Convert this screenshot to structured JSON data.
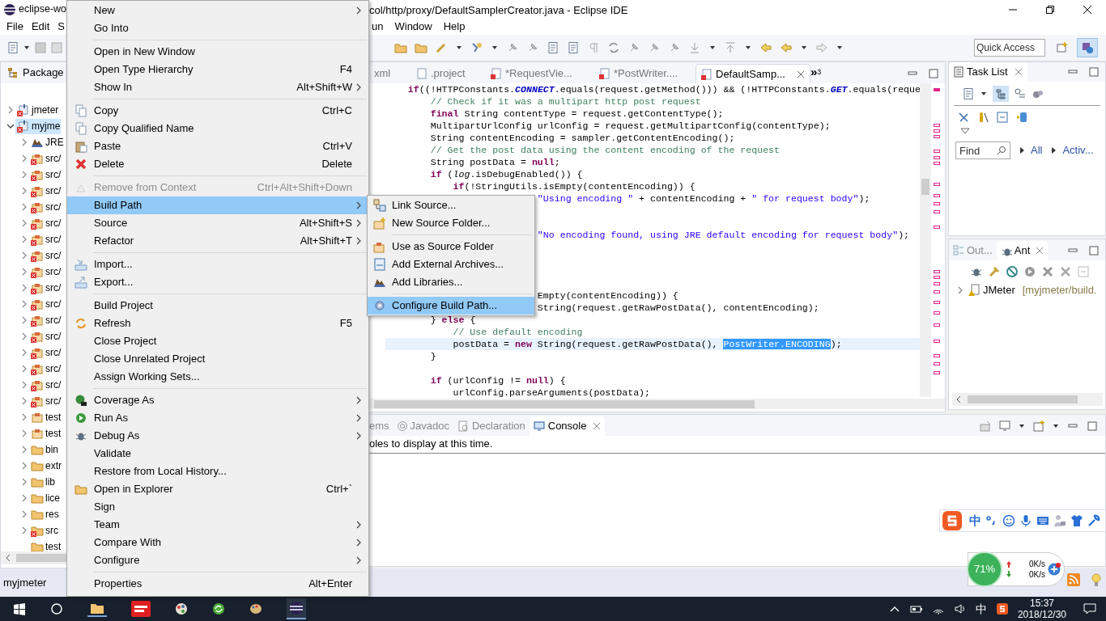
{
  "window": {
    "title_left": "eclipse-wo",
    "title_right": "col/http/proxy/DefaultSamplerCreator.java - Eclipse IDE"
  },
  "menu_bar": [
    {
      "label": "File"
    },
    {
      "label": "Edit"
    },
    {
      "label": "S"
    },
    {
      "label": "un"
    },
    {
      "label": "Window"
    },
    {
      "label": "Help"
    }
  ],
  "quick_access": {
    "placeholder": "Quick Access"
  },
  "package_explorer": {
    "title": "Package",
    "tree": [
      {
        "label": "jmeter",
        "kind": "project",
        "error": true,
        "expanded": false,
        "leaf": false,
        "selected": false
      },
      {
        "label": "myjme",
        "kind": "project",
        "error": true,
        "expanded": true,
        "leaf": false,
        "selected": true,
        "children": [
          {
            "label": "JRE",
            "kind": "library",
            "error": false,
            "leaf": false,
            "selected": false
          },
          {
            "label": "src/",
            "kind": "package",
            "error": true,
            "leaf": false,
            "selected": false
          },
          {
            "label": "src/",
            "kind": "package",
            "error": true,
            "leaf": false,
            "selected": false
          },
          {
            "label": "src/",
            "kind": "package",
            "error": true,
            "leaf": false,
            "selected": false
          },
          {
            "label": "src/",
            "kind": "package",
            "error": true,
            "leaf": false,
            "selected": false
          },
          {
            "label": "src/",
            "kind": "package",
            "error": true,
            "leaf": false,
            "selected": false
          },
          {
            "label": "src/",
            "kind": "package",
            "error": true,
            "leaf": false,
            "selected": false
          },
          {
            "label": "src/",
            "kind": "package",
            "error": true,
            "leaf": false,
            "selected": false
          },
          {
            "label": "src/",
            "kind": "package",
            "error": true,
            "leaf": false,
            "selected": false
          },
          {
            "label": "src/",
            "kind": "package",
            "error": true,
            "leaf": false,
            "selected": false
          },
          {
            "label": "src/",
            "kind": "package",
            "error": true,
            "leaf": false,
            "selected": false
          },
          {
            "label": "src/",
            "kind": "package",
            "error": true,
            "leaf": false,
            "selected": false
          },
          {
            "label": "src/",
            "kind": "package",
            "error": true,
            "leaf": false,
            "selected": false
          },
          {
            "label": "src/",
            "kind": "package",
            "error": true,
            "leaf": false,
            "selected": false
          },
          {
            "label": "src/",
            "kind": "package",
            "error": true,
            "leaf": false,
            "selected": false
          },
          {
            "label": "src/",
            "kind": "package",
            "error": true,
            "leaf": false,
            "selected": false
          },
          {
            "label": "src/",
            "kind": "package",
            "error": true,
            "leaf": false,
            "selected": false
          },
          {
            "label": "test",
            "kind": "package",
            "error": false,
            "leaf": false,
            "selected": false
          },
          {
            "label": "test",
            "kind": "package",
            "error": false,
            "leaf": false,
            "selected": false
          },
          {
            "label": "bin",
            "kind": "folder",
            "error": false,
            "leaf": false,
            "selected": false
          },
          {
            "label": "extr",
            "kind": "folder",
            "error": false,
            "leaf": false,
            "selected": false
          },
          {
            "label": "lib",
            "kind": "folder",
            "error": false,
            "leaf": false,
            "selected": false
          },
          {
            "label": "lice",
            "kind": "folder",
            "error": false,
            "leaf": false,
            "selected": false
          },
          {
            "label": "res",
            "kind": "folder",
            "error": false,
            "leaf": false,
            "selected": false
          },
          {
            "label": "src",
            "kind": "folder",
            "error": true,
            "leaf": false,
            "selected": false
          },
          {
            "label": "test",
            "kind": "folder",
            "error": false,
            "leaf": true,
            "selected": false
          }
        ]
      }
    ]
  },
  "editor": {
    "tabs": [
      {
        "label": "xml",
        "selected": false
      },
      {
        "label": ".project",
        "selected": false,
        "dirty": false
      },
      {
        "label": "*RequestVie...",
        "selected": false,
        "dirty": true
      },
      {
        "label": "*PostWriter....",
        "selected": false,
        "dirty": true
      },
      {
        "label": "DefaultSamp...",
        "selected": true,
        "dirty": false
      }
    ],
    "more_tabs": "»",
    "more_count": "3",
    "lines": [
      {
        "current": false,
        "segments": [
          {
            "text": "    if",
            "kind": "kw"
          },
          {
            "text": "((!HTTPConstants.",
            "kind": "plain"
          },
          {
            "text": "CONNECT",
            "kind": "field"
          },
          {
            "text": ".equals(request.getMethod())) && (!HTTPConstants.",
            "kind": "plain"
          },
          {
            "text": "GET",
            "kind": "field"
          },
          {
            "text": ".equals(reque",
            "kind": "plain"
          }
        ]
      },
      {
        "current": false,
        "segments": [
          {
            "text": "        // Check if it was a multipart http post request",
            "kind": "comment"
          }
        ]
      },
      {
        "current": false,
        "segments": [
          {
            "text": "        final",
            "kind": "kw"
          },
          {
            "text": " String contentType = request.getContentType();",
            "kind": "plain"
          }
        ]
      },
      {
        "current": false,
        "segments": [
          {
            "text": "        MultipartUrlConfig urlConfig = request.getMultipartConfig(contentType);",
            "kind": "plain"
          }
        ]
      },
      {
        "current": false,
        "segments": [
          {
            "text": "        String contentEncoding = sampler.getContentEncoding();",
            "kind": "plain"
          }
        ]
      },
      {
        "current": false,
        "segments": [
          {
            "text": "        // Get the post data using the content encoding of the request",
            "kind": "comment"
          }
        ]
      },
      {
        "current": false,
        "segments": [
          {
            "text": "        String postData = ",
            "kind": "plain"
          },
          {
            "text": "null",
            "kind": "kw"
          },
          {
            "text": ";",
            "kind": "plain"
          }
        ]
      },
      {
        "current": false,
        "segments": [
          {
            "text": "        if",
            "kind": "kw"
          },
          {
            "text": " (",
            "kind": "plain"
          },
          {
            "text": "log",
            "kind": "static"
          },
          {
            "text": ".isDebugEnabled()) {",
            "kind": "plain"
          }
        ]
      },
      {
        "current": false,
        "segments": [
          {
            "text": "            if",
            "kind": "kw"
          },
          {
            "text": "(!StringUtils.isEmpty(contentEncoding)) {",
            "kind": "plain"
          }
        ]
      },
      {
        "current": false,
        "segments": [
          {
            "text": "                           \"Using encoding \"",
            "kind": "string"
          },
          {
            "text": " + contentEncoding + ",
            "kind": "plain"
          },
          {
            "text": "\" for request body\"",
            "kind": "string"
          },
          {
            "text": ");",
            "kind": "plain"
          }
        ]
      },
      {
        "current": false
      },
      {
        "current": false
      },
      {
        "current": false,
        "segments": [
          {
            "text": "                           \"No encoding found, using JRE default encoding for request body\"",
            "kind": "string"
          },
          {
            "text": ");",
            "kind": "plain"
          }
        ]
      },
      {
        "current": false
      },
      {
        "current": false
      },
      {
        "current": false
      },
      {
        "current": false
      },
      {
        "current": false,
        "segments": [
          {
            "text": "                           Empty(contentEncoding)) {",
            "kind": "plain"
          }
        ]
      },
      {
        "current": false,
        "segments": [
          {
            "text": "                           String(request.getRawPostData(), contentEncoding);",
            "kind": "plain"
          }
        ]
      },
      {
        "current": false,
        "segments": [
          {
            "text": "        } ",
            "kind": "plain"
          },
          {
            "text": "else",
            "kind": "kw"
          },
          {
            "text": " {",
            "kind": "plain"
          }
        ]
      },
      {
        "current": false,
        "segments": [
          {
            "text": "            // Use default encoding",
            "kind": "comment"
          }
        ]
      },
      {
        "current": true,
        "segments": [
          {
            "text": "            postData = ",
            "kind": "plain"
          },
          {
            "text": "new",
            "kind": "kw"
          },
          {
            "text": " String(request.getRawPostData(), ",
            "kind": "plain"
          },
          {
            "text": "PostWriter.ENCODING",
            "kind": "selection"
          },
          {
            "text": ");",
            "kind": "plain"
          }
        ]
      },
      {
        "current": false,
        "segments": [
          {
            "text": "        }",
            "kind": "plain"
          }
        ]
      },
      {
        "current": false
      },
      {
        "current": false,
        "segments": [
          {
            "text": "        if",
            "kind": "kw"
          },
          {
            "text": " (urlConfig != ",
            "kind": "plain"
          },
          {
            "text": "null",
            "kind": "kw"
          },
          {
            "text": ") {",
            "kind": "plain"
          }
        ]
      },
      {
        "current": false,
        "segments": [
          {
            "text": "            urlConfig.parseArguments(postData);",
            "kind": "plain"
          }
        ]
      }
    ]
  },
  "task_list": {
    "title": "Task List",
    "find": {
      "placeholder": "Find"
    },
    "filters": [
      {
        "label": "All"
      },
      {
        "label": "Activ..."
      }
    ]
  },
  "ant_panel": {
    "tabs": [
      {
        "label": "Out...",
        "selected": false
      },
      {
        "label": "Ant",
        "selected": true
      }
    ],
    "tree": [
      {
        "label": "JMeter",
        "detail": "[myjmeter/build."
      }
    ]
  },
  "console": {
    "tabs": [
      {
        "label": "ems",
        "selected": false
      },
      {
        "label": "Javadoc",
        "selected": false
      },
      {
        "label": "Declaration",
        "selected": false
      },
      {
        "label": "Console",
        "selected": true
      }
    ],
    "message": "oles to display at this time."
  },
  "status_bar": {
    "text": "myjmeter"
  },
  "context_menu": {
    "items": [
      {
        "kind": "item",
        "label": "New",
        "submenu": true,
        "disabled": false,
        "selected": false
      },
      {
        "kind": "item",
        "label": "Go Into",
        "submenu": false,
        "disabled": false,
        "selected": false
      },
      {
        "kind": "separator"
      },
      {
        "kind": "item",
        "label": "Open in New Window",
        "submenu": false,
        "disabled": false,
        "selected": false
      },
      {
        "kind": "item",
        "label": "Open Type Hierarchy",
        "shortcut": "F4",
        "submenu": false,
        "disabled": false,
        "selected": false
      },
      {
        "kind": "item",
        "label": "Show In",
        "shortcut": "Alt+Shift+W",
        "submenu": true,
        "disabled": false,
        "selected": false
      },
      {
        "kind": "separator"
      },
      {
        "kind": "item",
        "label": "Copy",
        "shortcut": "Ctrl+C",
        "submenu": false,
        "disabled": false,
        "selected": false
      },
      {
        "kind": "item",
        "label": "Copy Qualified Name",
        "submenu": false,
        "disabled": false,
        "selected": false
      },
      {
        "kind": "item",
        "label": "Paste",
        "shortcut": "Ctrl+V",
        "submenu": false,
        "disabled": false,
        "selected": false
      },
      {
        "kind": "item",
        "label": "Delete",
        "shortcut": "Delete",
        "submenu": false,
        "disabled": false,
        "selected": false
      },
      {
        "kind": "separator"
      },
      {
        "kind": "item",
        "label": "Remove from Context",
        "shortcut": "Ctrl+Alt+Shift+Down",
        "submenu": false,
        "disabled": true,
        "selected": false
      },
      {
        "kind": "item",
        "label": "Build Path",
        "submenu": true,
        "disabled": false,
        "selected": true
      },
      {
        "kind": "item",
        "label": "Source",
        "shortcut": "Alt+Shift+S",
        "submenu": true,
        "disabled": false,
        "selected": false
      },
      {
        "kind": "item",
        "label": "Refactor",
        "shortcut": "Alt+Shift+T",
        "submenu": true,
        "disabled": false,
        "selected": false
      },
      {
        "kind": "separator"
      },
      {
        "kind": "item",
        "label": "Import...",
        "submenu": false,
        "disabled": false,
        "selected": false
      },
      {
        "kind": "item",
        "label": "Export...",
        "submenu": false,
        "disabled": false,
        "selected": false
      },
      {
        "kind": "separator"
      },
      {
        "kind": "item",
        "label": "Build Project",
        "submenu": false,
        "disabled": false,
        "selected": false
      },
      {
        "kind": "item",
        "label": "Refresh",
        "shortcut": "F5",
        "submenu": false,
        "disabled": false,
        "selected": false
      },
      {
        "kind": "item",
        "label": "Close Project",
        "submenu": false,
        "disabled": false,
        "selected": false
      },
      {
        "kind": "item",
        "label": "Close Unrelated Project",
        "submenu": false,
        "disabled": false,
        "selected": false
      },
      {
        "kind": "item",
        "label": "Assign Working Sets...",
        "submenu": false,
        "disabled": false,
        "selected": false
      },
      {
        "kind": "separator"
      },
      {
        "kind": "item",
        "label": "Coverage As",
        "submenu": true,
        "disabled": false,
        "selected": false
      },
      {
        "kind": "item",
        "label": "Run As",
        "submenu": true,
        "disabled": false,
        "selected": false
      },
      {
        "kind": "item",
        "label": "Debug As",
        "submenu": true,
        "disabled": false,
        "selected": false
      },
      {
        "kind": "item",
        "label": "Validate",
        "submenu": false,
        "disabled": false,
        "selected": false
      },
      {
        "kind": "item",
        "label": "Restore from Local History...",
        "submenu": false,
        "disabled": false,
        "selected": false
      },
      {
        "kind": "item",
        "label": "Open in Explorer",
        "shortcut": "Ctrl+`",
        "submenu": false,
        "disabled": false,
        "selected": false
      },
      {
        "kind": "item",
        "label": "Sign",
        "submenu": false,
        "disabled": false,
        "selected": false
      },
      {
        "kind": "item",
        "label": "Team",
        "submenu": true,
        "disabled": false,
        "selected": false
      },
      {
        "kind": "item",
        "label": "Compare With",
        "submenu": true,
        "disabled": false,
        "selected": false
      },
      {
        "kind": "item",
        "label": "Configure",
        "submenu": true,
        "disabled": false,
        "selected": false
      },
      {
        "kind": "separator"
      },
      {
        "kind": "item",
        "label": "Properties",
        "shortcut": "Alt+Enter",
        "submenu": false,
        "disabled": false,
        "selected": false
      }
    ]
  },
  "build_path_submenu": {
    "items": [
      {
        "kind": "item",
        "label": "Link Source...",
        "selected": false
      },
      {
        "kind": "item",
        "label": "New Source Folder...",
        "selected": false
      },
      {
        "kind": "separator"
      },
      {
        "kind": "item",
        "label": "Use as Source Folder",
        "selected": false
      },
      {
        "kind": "item",
        "label": "Add External Archives...",
        "selected": false
      },
      {
        "kind": "item",
        "label": "Add Libraries...",
        "selected": false
      },
      {
        "kind": "separator"
      },
      {
        "kind": "item",
        "label": "Configure Build Path...",
        "selected": true
      }
    ]
  },
  "ime_bar": {
    "mode": "中"
  },
  "network_widget": {
    "percent": "71%",
    "upload": "0K/s",
    "download": "0K/s"
  },
  "taskbar": {
    "ime": "中",
    "time": "15:37",
    "date": "2018/12/30"
  }
}
